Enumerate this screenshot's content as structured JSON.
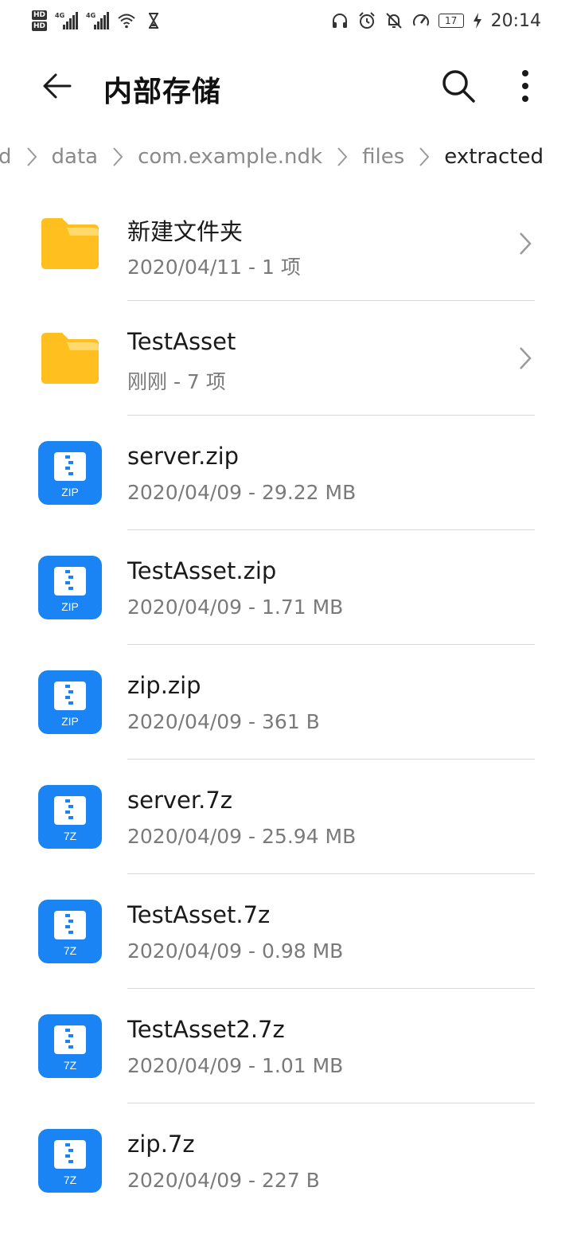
{
  "status_bar": {
    "time": "20:14",
    "battery": "17",
    "network_labels": [
      "4G",
      "4G"
    ],
    "hd_badges": [
      "HD",
      "HD"
    ]
  },
  "header": {
    "title": "内部存储"
  },
  "breadcrumb": {
    "items": [
      "d",
      "data",
      "com.example.ndk",
      "files",
      "extracted"
    ]
  },
  "files": [
    {
      "name": "新建文件夹",
      "meta": "2020/04/11 - 1 项",
      "type": "folder"
    },
    {
      "name": "TestAsset",
      "meta": "刚刚 - 7 项",
      "type": "folder"
    },
    {
      "name": "server.zip",
      "meta": "2020/04/09 - 29.22 MB",
      "type": "archive",
      "ext": "ZIP"
    },
    {
      "name": "TestAsset.zip",
      "meta": "2020/04/09 - 1.71 MB",
      "type": "archive",
      "ext": "ZIP"
    },
    {
      "name": "zip.zip",
      "meta": "2020/04/09 - 361 B",
      "type": "archive",
      "ext": "ZIP"
    },
    {
      "name": "server.7z",
      "meta": "2020/04/09 - 25.94 MB",
      "type": "archive",
      "ext": "7Z"
    },
    {
      "name": "TestAsset.7z",
      "meta": "2020/04/09 - 0.98 MB",
      "type": "archive",
      "ext": "7Z"
    },
    {
      "name": "TestAsset2.7z",
      "meta": "2020/04/09 - 1.01 MB",
      "type": "archive",
      "ext": "7Z"
    },
    {
      "name": "zip.7z",
      "meta": "2020/04/09 - 227 B",
      "type": "archive",
      "ext": "7Z"
    }
  ],
  "colors": {
    "folder": "#FFBF1F",
    "folder_tab": "#FFD96B",
    "archive": "#1A84F5",
    "divider": "#D9D9D9"
  }
}
